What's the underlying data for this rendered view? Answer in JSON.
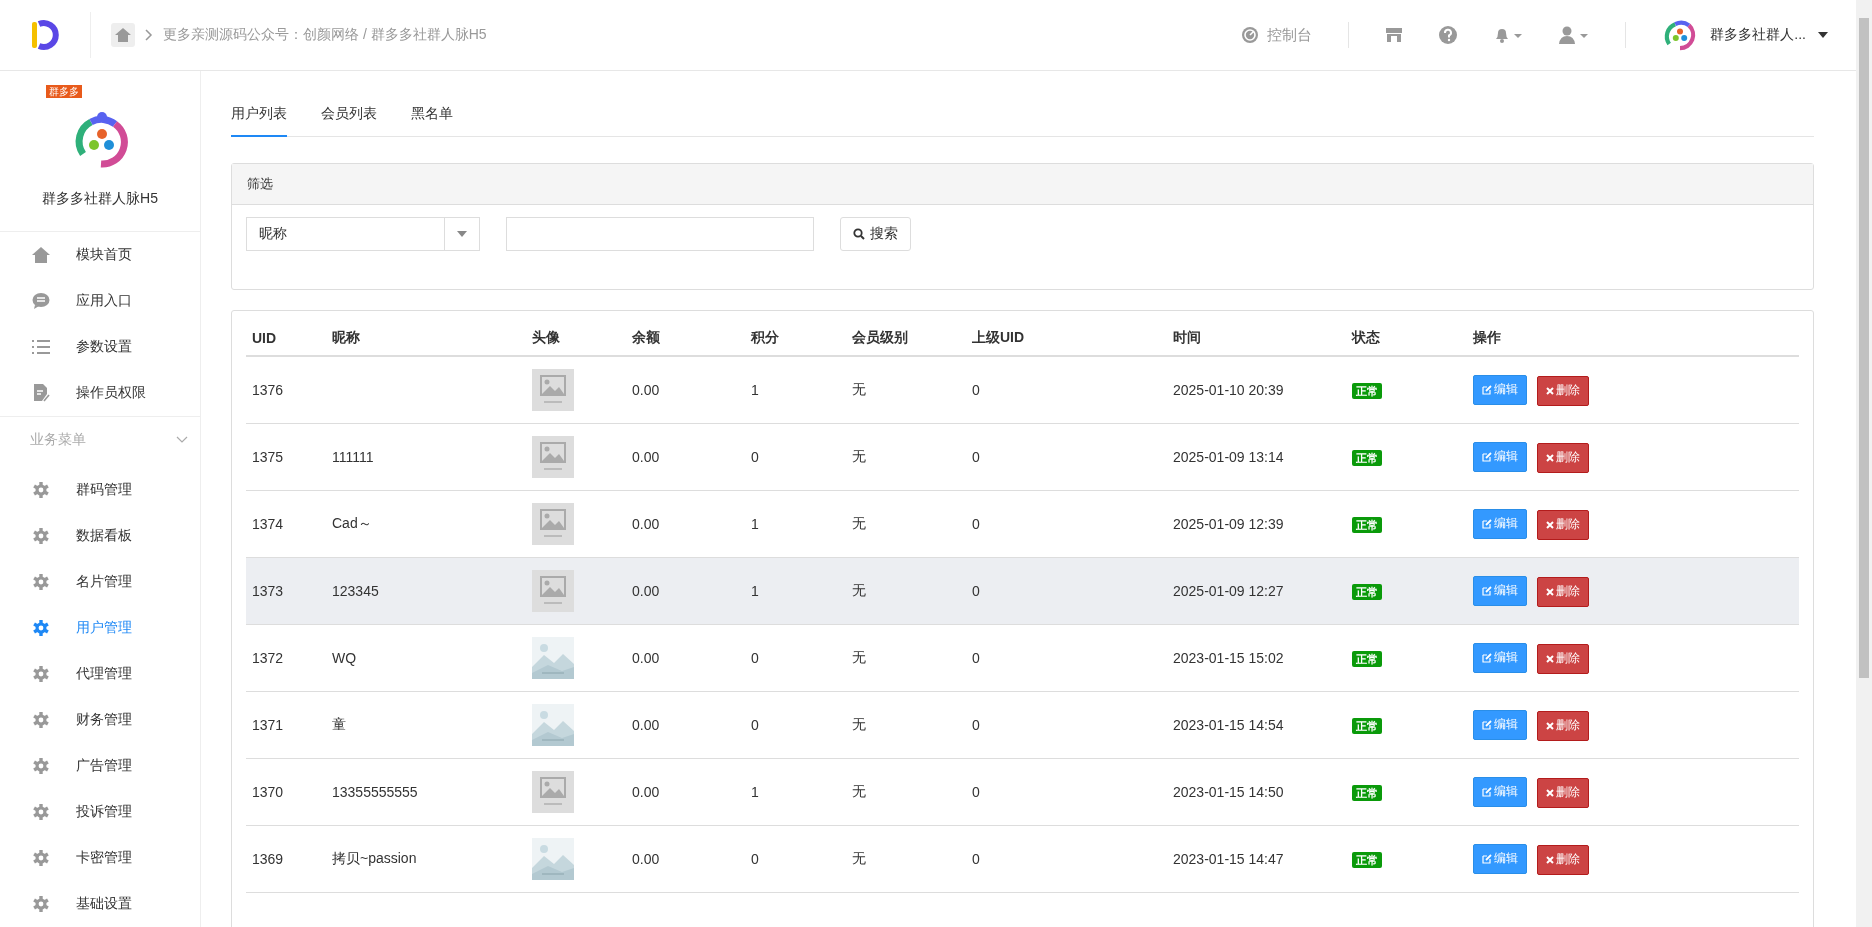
{
  "header": {
    "breadcrumb": "更多亲测源码公众号：创颜网络 / 群多多社群人脉H5",
    "console": "控制台",
    "account": "群多多社群人..."
  },
  "sidebar": {
    "app_name": "群多多社群人脉H5",
    "badge": "群多多",
    "items": [
      {
        "label": "模块首页",
        "kind": "home",
        "selected": false
      },
      {
        "label": "应用入口",
        "kind": "chat",
        "selected": false
      },
      {
        "label": "参数设置",
        "kind": "list",
        "selected": false
      },
      {
        "label": "操作员权限",
        "kind": "doc",
        "selected": false
      }
    ],
    "section": "业务菜单",
    "section_items": [
      {
        "label": "群码管理",
        "selected": false
      },
      {
        "label": "数据看板",
        "selected": false
      },
      {
        "label": "名片管理",
        "selected": false
      },
      {
        "label": "用户管理",
        "selected": true
      },
      {
        "label": "代理管理",
        "selected": false
      },
      {
        "label": "财务管理",
        "selected": false
      },
      {
        "label": "广告管理",
        "selected": false
      },
      {
        "label": "投诉管理",
        "selected": false
      },
      {
        "label": "卡密管理",
        "selected": false
      },
      {
        "label": "基础设置",
        "selected": false
      }
    ]
  },
  "tabs": [
    {
      "label": "用户列表",
      "selected": true
    },
    {
      "label": "会员列表",
      "selected": false
    },
    {
      "label": "黑名单",
      "selected": false
    }
  ],
  "filter": {
    "title": "筛选",
    "select": "昵称",
    "search_button": "搜索"
  },
  "table": {
    "columns": [
      "UID",
      "昵称",
      "头像",
      "余额",
      "积分",
      "会员级别",
      "上级UID",
      "时间",
      "状态",
      "操作"
    ],
    "rows": [
      {
        "uid": "1376",
        "nickname": "",
        "avatar": {
          "kind": "placeholder"
        },
        "balance": "0.00",
        "points": "1",
        "level": "无",
        "parent_uid": "0",
        "time": "2025-01-10 20:39",
        "status": "正常",
        "edit": "编辑",
        "delete": "删除",
        "selected": false
      },
      {
        "uid": "1375",
        "nickname": "111111",
        "avatar": {
          "kind": "placeholder"
        },
        "balance": "0.00",
        "points": "0",
        "level": "无",
        "parent_uid": "0",
        "time": "2025-01-09 13:14",
        "status": "正常",
        "edit": "编辑",
        "delete": "删除",
        "selected": false
      },
      {
        "uid": "1374",
        "nickname": "Cad～",
        "avatar": {
          "kind": "placeholder"
        },
        "balance": "0.00",
        "points": "1",
        "level": "无",
        "parent_uid": "0",
        "time": "2025-01-09 12:39",
        "status": "正常",
        "edit": "编辑",
        "delete": "删除",
        "selected": false
      },
      {
        "uid": "1373",
        "nickname": "123345",
        "avatar": {
          "kind": "placeholder"
        },
        "balance": "0.00",
        "points": "1",
        "level": "无",
        "parent_uid": "0",
        "time": "2025-01-09 12:27",
        "status": "正常",
        "edit": "编辑",
        "delete": "删除",
        "selected": true
      },
      {
        "uid": "1372",
        "nickname": "WQ",
        "balance": "0.00",
        "points": "0",
        "level": "无",
        "parent_uid": "0",
        "time": "2023-01-15 15:02",
        "status": "正常",
        "edit": "编辑",
        "delete": "删除",
        "selected": false
      },
      {
        "uid": "1371",
        "nickname": "童",
        "balance": "0.00",
        "points": "0",
        "level": "无",
        "parent_uid": "0",
        "time": "2023-01-15 14:54",
        "status": "正常",
        "edit": "编辑",
        "delete": "删除",
        "selected": false
      },
      {
        "uid": "1370",
        "nickname": "13355555555",
        "avatar": {
          "kind": "placeholder"
        },
        "balance": "0.00",
        "points": "1",
        "level": "无",
        "parent_uid": "0",
        "time": "2023-01-15 14:50",
        "status": "正常",
        "edit": "编辑",
        "delete": "删除",
        "selected": false
      },
      {
        "uid": "1369",
        "nickname": "拷贝~passion",
        "balance": "0.00",
        "points": "0",
        "level": "无",
        "parent_uid": "0",
        "time": "2023-01-15 14:47",
        "status": "正常",
        "edit": "编辑",
        "delete": "删除",
        "selected": false
      }
    ]
  }
}
